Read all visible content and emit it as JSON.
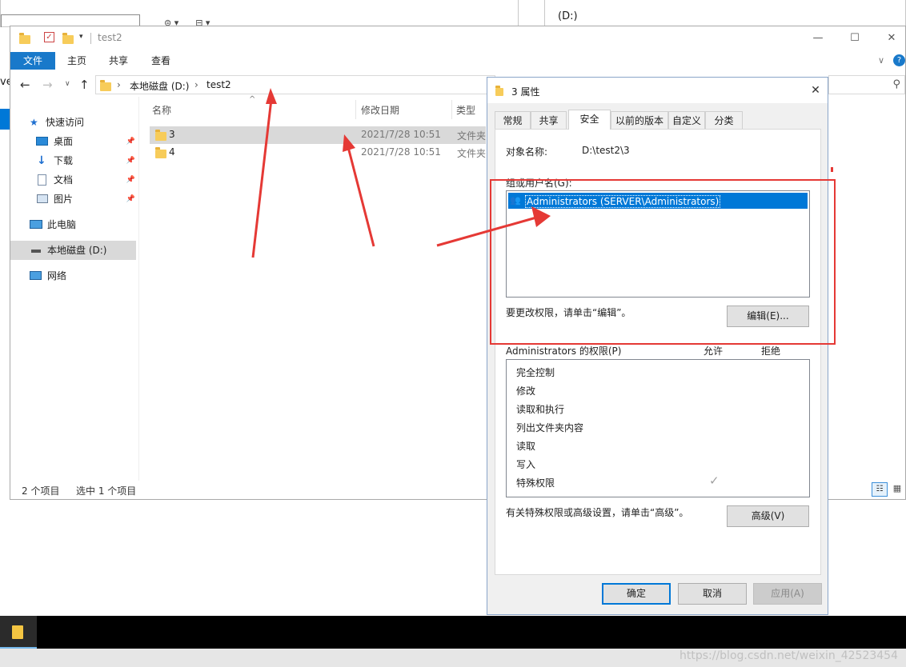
{
  "background_window": {
    "right_title": "(D:)",
    "left_edge_fragment": "ve"
  },
  "explorer": {
    "title": "test2",
    "window_controls": [
      "—",
      "☐",
      "✕"
    ],
    "ribbon_tabs": [
      {
        "label": "文件"
      },
      {
        "label": "主页"
      },
      {
        "label": "共享"
      },
      {
        "label": "查看"
      }
    ],
    "address": {
      "segment_1": "本地磁盘 (D:)",
      "separator": "›",
      "segment_2": "test2"
    },
    "nav": {
      "quick_access": "快速访问",
      "desktop": "桌面",
      "downloads": "下载",
      "documents": "文档",
      "pictures": "图片",
      "this_pc": "此电脑",
      "local_disk": "本地磁盘 (D:)",
      "network": "网络"
    },
    "columns": {
      "name": "名称",
      "date": "修改日期",
      "type": "类型"
    },
    "files": [
      {
        "name": "3",
        "date": "2021/7/28 10:51",
        "type": "文件夹"
      },
      {
        "name": "4",
        "date": "2021/7/28 10:51",
        "type": "文件夹"
      }
    ],
    "status": {
      "count": "2 个项目",
      "selected": "选中 1 个项目"
    }
  },
  "dialog": {
    "title": "3 属性",
    "close": "✕",
    "tabs": [
      {
        "label": "常规"
      },
      {
        "label": "共享"
      },
      {
        "label": "安全"
      },
      {
        "label": "以前的版本"
      },
      {
        "label": "自定义"
      },
      {
        "label": "分类"
      }
    ],
    "object_name_label": "对象名称:",
    "object_name_value": "D:\\test2\\3",
    "group_label": "组或用户名(G):",
    "group_users": [
      {
        "name": "Administrators (SERVER\\Administrators)",
        "selected": true
      }
    ],
    "change_permissions_text": "要更改权限，请单击“编辑”。",
    "edit_button": "编辑(E)...",
    "permissions_label": "Administrators 的权限(P)",
    "allow_label": "允许",
    "deny_label": "拒绝",
    "permissions": [
      {
        "name": "完全控制",
        "allow": false
      },
      {
        "name": "修改",
        "allow": false
      },
      {
        "name": "读取和执行",
        "allow": false
      },
      {
        "name": "列出文件夹内容",
        "allow": false
      },
      {
        "name": "读取",
        "allow": false
      },
      {
        "name": "写入",
        "allow": false
      },
      {
        "name": "特殊权限",
        "allow": true
      }
    ],
    "check_mark": "✓",
    "advanced_text": "有关特殊权限或高级设置，请单击“高级”。",
    "advanced_button": "高级(V)",
    "ok_button": "确定",
    "cancel_button": "取消",
    "apply_button": "应用(A)"
  },
  "watermark": "https://blog.csdn.net/weixin_42523454",
  "colors": {
    "accent": "#0078d7",
    "annotation_red": "#e53935",
    "selection": "#d9d9d9"
  }
}
